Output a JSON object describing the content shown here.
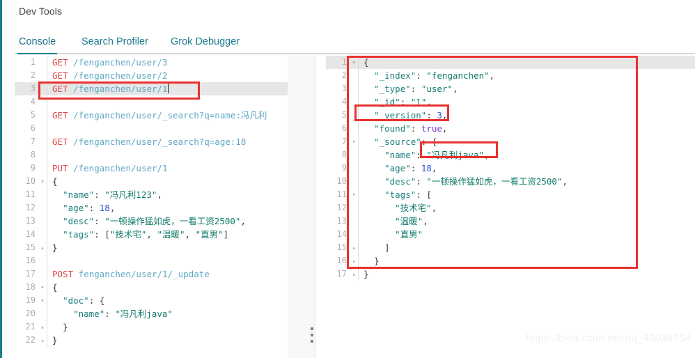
{
  "app": {
    "title": "Dev Tools",
    "accent_color": "#1b7f8c",
    "annotation_color": "#e8312f"
  },
  "tabs": [
    {
      "label": "Console",
      "active": true
    },
    {
      "label": "Search Profiler",
      "active": false
    },
    {
      "label": "Grok Debugger",
      "active": false
    }
  ],
  "actions": {
    "run_icon": "play-icon",
    "settings_icon": "wrench-icon"
  },
  "request_editor": {
    "name": "request-editor",
    "active_line": 3,
    "lines": [
      {
        "n": "1",
        "fold": "",
        "html": "<span class='t-method'>GET</span> <span class='t-url'>/fenganchen/user/3</span>"
      },
      {
        "n": "2",
        "fold": "",
        "html": "<span class='t-method'>GET</span> <span class='t-url'>/fenganchen/user/2</span>"
      },
      {
        "n": "3",
        "fold": "",
        "html": "<span class='t-method'>GET</span> <span class='t-url'>/fenganchen/user/1</span><span class='caret'></span>"
      },
      {
        "n": "4",
        "fold": "",
        "html": ""
      },
      {
        "n": "5",
        "fold": "",
        "html": "<span class='t-method'>GET</span> <span class='t-url'>/fenganchen/user/_search?q=name:冯凡利</span>"
      },
      {
        "n": "6",
        "fold": "",
        "html": ""
      },
      {
        "n": "7",
        "fold": "",
        "html": "<span class='t-method'>GET</span> <span class='t-url'>/fenganchen/user/_search?q=age:18</span>"
      },
      {
        "n": "8",
        "fold": "",
        "html": ""
      },
      {
        "n": "9",
        "fold": "",
        "html": "<span class='t-method'>PUT</span> <span class='t-url'>/fenganchen/user/1</span>"
      },
      {
        "n": "10",
        "fold": "▾",
        "html": "<span class='t-brace'>{</span>"
      },
      {
        "n": "11",
        "fold": "",
        "html": "  <span class='t-key'>\"name\"</span><span class='t-punct'>:</span> <span class='t-str'>\"冯凡利123\"</span><span class='t-punct'>,</span>"
      },
      {
        "n": "12",
        "fold": "",
        "html": "  <span class='t-key'>\"age\"</span><span class='t-punct'>:</span> <span class='t-num'>18</span><span class='t-punct'>,</span>"
      },
      {
        "n": "13",
        "fold": "",
        "html": "  <span class='t-key'>\"desc\"</span><span class='t-punct'>:</span> <span class='t-str'>\"一顿操作猛如虎，一看工资2500\"</span><span class='t-punct'>,</span>"
      },
      {
        "n": "14",
        "fold": "",
        "html": "  <span class='t-key'>\"tags\"</span><span class='t-punct'>:</span> <span class='t-punct'>[</span><span class='t-str'>\"技术宅\"</span><span class='t-punct'>,</span> <span class='t-str'>\"温暖\"</span><span class='t-punct'>,</span> <span class='t-str'>\"直男\"</span><span class='t-punct'>]</span>"
      },
      {
        "n": "15",
        "fold": "▴",
        "html": "<span class='t-brace'>}</span>"
      },
      {
        "n": "16",
        "fold": "",
        "html": ""
      },
      {
        "n": "17",
        "fold": "",
        "html": "<span class='t-method'>POST</span> <span class='t-url'>fenganchen/user/1/_update</span>"
      },
      {
        "n": "18",
        "fold": "▾",
        "html": "<span class='t-brace'>{</span>"
      },
      {
        "n": "19",
        "fold": "▾",
        "html": "  <span class='t-key'>\"doc\"</span><span class='t-punct'>:</span> <span class='t-brace'>{</span>"
      },
      {
        "n": "20",
        "fold": "",
        "html": "    <span class='t-key'>\"name\"</span><span class='t-punct'>:</span> <span class='t-str'>\"冯凡利java\"</span>"
      },
      {
        "n": "21",
        "fold": "▴",
        "html": "  <span class='t-brace'>}</span>"
      },
      {
        "n": "22",
        "fold": "▴",
        "html": "<span class='t-brace'>}</span>"
      }
    ]
  },
  "response_viewer": {
    "name": "response-viewer",
    "active_line": 1,
    "lines": [
      {
        "n": "1",
        "fold": "▾",
        "html": "<span class='t-brace'>{</span>"
      },
      {
        "n": "2",
        "fold": "",
        "html": "  <span class='t-key'>\"_index\"</span><span class='t-punct'>:</span> <span class='t-str'>\"fenganchen\"</span><span class='t-punct'>,</span>"
      },
      {
        "n": "3",
        "fold": "",
        "html": "  <span class='t-key'>\"_type\"</span><span class='t-punct'>:</span> <span class='t-str'>\"user\"</span><span class='t-punct'>,</span>"
      },
      {
        "n": "4",
        "fold": "",
        "html": "  <span class='t-key'>\"_id\"</span><span class='t-punct'>:</span> <span class='t-str'>\"1\"</span><span class='t-punct'>,</span>"
      },
      {
        "n": "5",
        "fold": "",
        "html": "  <span class='t-key'>\"_version\"</span><span class='t-punct'>:</span> <span class='t-num'>3</span><span class='t-punct'>,</span>"
      },
      {
        "n": "6",
        "fold": "",
        "html": "  <span class='t-key'>\"found\"</span><span class='t-punct'>:</span> <span class='t-bool'>true</span><span class='t-punct'>,</span>"
      },
      {
        "n": "7",
        "fold": "▾",
        "html": "  <span class='t-key'>\"_source\"</span><span class='t-punct'>:</span> <span class='t-brace'>{</span>"
      },
      {
        "n": "8",
        "fold": "",
        "html": "    <span class='t-key'>\"name\"</span><span class='t-punct'>:</span> <span class='t-str'>\"冯凡利java\"</span><span class='t-punct'>,</span>"
      },
      {
        "n": "9",
        "fold": "",
        "html": "    <span class='t-key'>\"age\"</span><span class='t-punct'>:</span> <span class='t-num'>18</span><span class='t-punct'>,</span>"
      },
      {
        "n": "10",
        "fold": "",
        "html": "    <span class='t-key'>\"desc\"</span><span class='t-punct'>:</span> <span class='t-str'>\"一顿操作猛如虎，一看工资2500\"</span><span class='t-punct'>,</span>"
      },
      {
        "n": "11",
        "fold": "▾",
        "html": "    <span class='t-key'>\"tags\"</span><span class='t-punct'>:</span> <span class='t-punct'>[</span>"
      },
      {
        "n": "12",
        "fold": "",
        "html": "      <span class='t-str'>\"技术宅\"</span><span class='t-punct'>,</span>"
      },
      {
        "n": "13",
        "fold": "",
        "html": "      <span class='t-str'>\"温暖\"</span><span class='t-punct'>,</span>"
      },
      {
        "n": "14",
        "fold": "",
        "html": "      <span class='t-str'>\"直男\"</span>"
      },
      {
        "n": "15",
        "fold": "▴",
        "html": "    <span class='t-punct'>]</span>"
      },
      {
        "n": "16",
        "fold": "▴",
        "html": "  <span class='t-brace'>}</span>"
      },
      {
        "n": "17",
        "fold": "▴",
        "html": "<span class='t-brace'>}</span>"
      }
    ]
  },
  "annotations": [
    {
      "name": "annotation-request-line-3",
      "target": "GET /fenganchen/user/1"
    },
    {
      "name": "annotation-response-body",
      "target": "response JSON body"
    },
    {
      "name": "annotation-response-version",
      "target": "\"_version\": 3,"
    },
    {
      "name": "annotation-response-name-value",
      "target": "\"冯凡利java\","
    }
  ],
  "watermark": {
    "text": "https://blog.csdn.net/qq_40036754"
  }
}
